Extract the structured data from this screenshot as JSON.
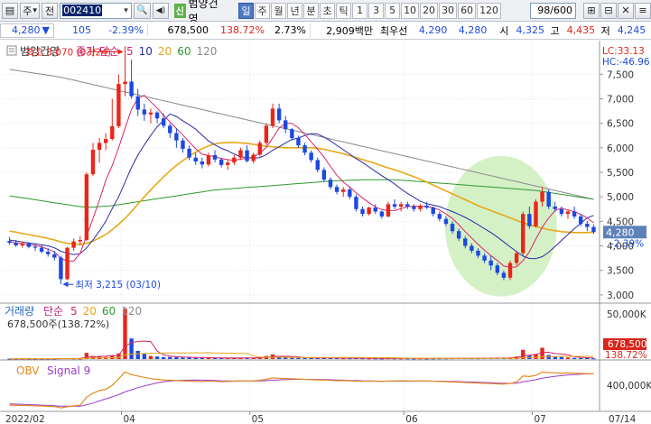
{
  "toolbar": {
    "list_icon": "▤",
    "market": "주",
    "market_arrow": "▾",
    "prev_label": "전",
    "code": "002410",
    "code_arrow": "▾",
    "search_icon": "🔍",
    "sound_icon": "◀)",
    "badge": "신",
    "stock_name": "범양건영",
    "periods": [
      "일",
      "주",
      "월",
      "년",
      "분",
      "초",
      "틱",
      "1",
      "3",
      "5",
      "10",
      "20",
      "30",
      "60",
      "120"
    ],
    "active_period": "일",
    "count": "98/600",
    "right_icons": [
      "⊞",
      "⊟",
      "✕",
      "≡"
    ]
  },
  "quote": {
    "price": "4,280",
    "change_arrow": "▼",
    "change": "105",
    "change_pct": "-2.39%",
    "volume": "678,500",
    "turnover_ratio": "138.72%",
    "ratio2": "2.73%",
    "amount": "2,909백만",
    "best_label": "최우선",
    "ask": "4,290",
    "bid": "4,280",
    "open_label": "시",
    "open": "4,325",
    "high_label": "고",
    "high": "4,435",
    "low_label": "저",
    "low": "4,245"
  },
  "price_panel": {
    "title": "범양건영",
    "legend_label": "종가 단순",
    "ma_periods": [
      "5",
      "10",
      "20",
      "60",
      "120"
    ],
    "lc_label": "LC:33.13",
    "hc_label": "HC:-46.96",
    "y_ticks": [
      "7,500",
      "7,000",
      "6,500",
      "6,000",
      "5,500",
      "5,000",
      "4,500",
      "4,000",
      "3,500",
      "3,000"
    ],
    "current_price": "4,280",
    "current_pct": "-2.39%",
    "high_annotation": "최고 8,070 (03/24)",
    "low_annotation": "최저 3,215 (03/10)"
  },
  "volume_panel": {
    "label": "거래량",
    "legend_label": "단순",
    "ma_periods": [
      "5",
      "20",
      "60",
      "120"
    ],
    "value_label": "678,500주(138.72%)",
    "y_tick": "50,000K",
    "current_value": "678,500",
    "current_pct": "138.72%"
  },
  "obv_panel": {
    "label": "OBV",
    "signal_label": "Signal 9",
    "y_tick": "400,000K"
  },
  "x_axis": {
    "labels": [
      "2022/02",
      "04",
      "05",
      "06",
      "07",
      "07/14"
    ]
  },
  "colors": {
    "up": "#e8261b",
    "down": "#1c48e0",
    "ma5": "#d8246c",
    "ma10": "#2a2aa6",
    "ma20": "#e6a817",
    "ma60": "#2e9a2e",
    "ma120": "#8a8a8a",
    "obv": "#e28a1e",
    "signal": "#9b3ad1",
    "highlight": "#cdeebc",
    "price_box": "#5e82b8",
    "volume_box": "#d8261c"
  },
  "chart_data": {
    "type": "candlestick",
    "price_range": [
      2850,
      8150
    ],
    "candles": [
      [
        4100,
        4180,
        4020,
        4060
      ],
      [
        4060,
        4120,
        3980,
        4010
      ],
      [
        4010,
        4090,
        3960,
        4050
      ],
      [
        4050,
        4070,
        3950,
        3980
      ],
      [
        3980,
        4040,
        3900,
        3960
      ],
      [
        3960,
        4010,
        3850,
        3880
      ],
      [
        3880,
        3950,
        3780,
        3830
      ],
      [
        3830,
        3900,
        3700,
        3760
      ],
      [
        3760,
        3800,
        3215,
        3320
      ],
      [
        3320,
        3980,
        3300,
        3960
      ],
      [
        3960,
        4150,
        3900,
        4090
      ],
      [
        4090,
        4200,
        4010,
        4120
      ],
      [
        4120,
        5500,
        4100,
        5460
      ],
      [
        5460,
        6100,
        5420,
        5960
      ],
      [
        5960,
        6200,
        5700,
        6100
      ],
      [
        6100,
        6300,
        5950,
        6180
      ],
      [
        6180,
        7000,
        6150,
        6440
      ],
      [
        6440,
        7500,
        6400,
        7300
      ],
      [
        7300,
        8070,
        7050,
        7350
      ],
      [
        7350,
        7800,
        7000,
        7050
      ],
      [
        7050,
        7200,
        6650,
        6780
      ],
      [
        6780,
        6900,
        6550,
        6680
      ],
      [
        6680,
        6800,
        6500,
        6720
      ],
      [
        6720,
        6750,
        6500,
        6600
      ],
      [
        6600,
        6700,
        6400,
        6450
      ],
      [
        6450,
        6500,
        6200,
        6300
      ],
      [
        6300,
        6400,
        6000,
        6150
      ],
      [
        6150,
        6200,
        5900,
        5980
      ],
      [
        5980,
        6050,
        5750,
        5800
      ],
      [
        5800,
        5900,
        5650,
        5720
      ],
      [
        5720,
        5800,
        5580,
        5660
      ],
      [
        5660,
        5900,
        5620,
        5850
      ],
      [
        5850,
        5950,
        5700,
        5760
      ],
      [
        5760,
        5800,
        5600,
        5650
      ],
      [
        5650,
        5750,
        5550,
        5700
      ],
      [
        5700,
        5850,
        5650,
        5800
      ],
      [
        5800,
        6000,
        5750,
        5950
      ],
      [
        5950,
        6050,
        5700,
        5730
      ],
      [
        5730,
        5900,
        5680,
        5860
      ],
      [
        5860,
        6150,
        5820,
        6100
      ],
      [
        6100,
        6500,
        6050,
        6450
      ],
      [
        6450,
        6900,
        6400,
        6800
      ],
      [
        6800,
        6900,
        6500,
        6560
      ],
      [
        6560,
        6650,
        6300,
        6380
      ],
      [
        6380,
        6400,
        6150,
        6200
      ],
      [
        6200,
        6250,
        6000,
        6050
      ],
      [
        6050,
        6100,
        5850,
        5900
      ],
      [
        5900,
        5950,
        5700,
        5750
      ],
      [
        5750,
        5800,
        5500,
        5550
      ],
      [
        5550,
        5600,
        5300,
        5350
      ],
      [
        5350,
        5400,
        5150,
        5200
      ],
      [
        5200,
        5250,
        5050,
        5100
      ],
      [
        5100,
        5200,
        5000,
        5150
      ],
      [
        5150,
        5200,
        4950,
        5000
      ],
      [
        5000,
        5050,
        4700,
        4750
      ],
      [
        4750,
        4800,
        4600,
        4650
      ],
      [
        4650,
        4800,
        4620,
        4780
      ],
      [
        4780,
        4850,
        4650,
        4700
      ],
      [
        4700,
        4720,
        4550,
        4600
      ],
      [
        4600,
        4900,
        4580,
        4850
      ],
      [
        4850,
        4950,
        4750,
        4800
      ],
      [
        4800,
        4900,
        4700,
        4850
      ],
      [
        4850,
        4900,
        4750,
        4800
      ],
      [
        4800,
        4850,
        4700,
        4750
      ],
      [
        4750,
        4850,
        4700,
        4820
      ],
      [
        4820,
        4900,
        4750,
        4780
      ],
      [
        4780,
        4800,
        4600,
        4650
      ],
      [
        4650,
        4700,
        4500,
        4550
      ],
      [
        4550,
        4600,
        4400,
        4450
      ],
      [
        4450,
        4500,
        4250,
        4300
      ],
      [
        4300,
        4350,
        4100,
        4150
      ],
      [
        4150,
        4200,
        3950,
        4000
      ],
      [
        4000,
        4050,
        3850,
        3900
      ],
      [
        3900,
        3950,
        3750,
        3800
      ],
      [
        3800,
        3850,
        3650,
        3700
      ],
      [
        3700,
        3800,
        3500,
        3600
      ],
      [
        3600,
        3650,
        3400,
        3450
      ],
      [
        3450,
        3500,
        3300,
        3350
      ],
      [
        3350,
        3700,
        3300,
        3650
      ],
      [
        3650,
        3900,
        3600,
        3850
      ],
      [
        3850,
        4700,
        3800,
        4650
      ],
      [
        4650,
        4800,
        4350,
        4400
      ],
      [
        4400,
        4950,
        4380,
        4900
      ],
      [
        4900,
        5200,
        4800,
        5100
      ],
      [
        5100,
        5150,
        4750,
        4800
      ],
      [
        4800,
        4900,
        4700,
        4750
      ],
      [
        4750,
        4800,
        4600,
        4650
      ],
      [
        4650,
        4750,
        4550,
        4700
      ],
      [
        4700,
        4800,
        4550,
        4600
      ],
      [
        4600,
        4650,
        4400,
        4450
      ],
      [
        4450,
        4500,
        4300,
        4385
      ],
      [
        4385,
        4435,
        4245,
        4280
      ]
    ],
    "ma5": [
      4080,
      4060,
      4040,
      4020,
      4010,
      3980,
      3930,
      3880,
      3740,
      3690,
      3690,
      3850,
      4200,
      4560,
      4930,
      5340,
      5640,
      6000,
      6400,
      6780,
      7010,
      7070,
      6940,
      6810,
      6660,
      6530,
      6390,
      6260,
      6120,
      5980,
      5870,
      5840,
      5820,
      5780,
      5760,
      5740,
      5770,
      5780,
      5820,
      5890,
      6010,
      6200,
      6400,
      6500,
      6500,
      6410,
      6270,
      6120,
      5970,
      5810,
      5620,
      5440,
      5300,
      5200,
      5080,
      4980,
      4880,
      4790,
      4740,
      4720,
      4720,
      4760,
      4800,
      4810,
      4810,
      4800,
      4780,
      4730,
      4650,
      4560,
      4430,
      4290,
      4160,
      4030,
      3910,
      3800,
      3700,
      3590,
      3560,
      3570,
      3700,
      3880,
      4140,
      4380,
      4570,
      4720,
      4770,
      4730,
      4700,
      4640,
      4570,
      4470
    ],
    "ma10": [
      4120,
      4100,
      4080,
      4060,
      4040,
      4020,
      4000,
      3960,
      3890,
      3850,
      3820,
      3840,
      3960,
      4120,
      4300,
      4500,
      4760,
      5000,
      5300,
      5600,
      5850,
      6060,
      6250,
      6430,
      6560,
      6690,
      6640,
      6550,
      6470,
      6380,
      6260,
      6140,
      6060,
      5990,
      5940,
      5870,
      5820,
      5800,
      5790,
      5800,
      5860,
      5950,
      6020,
      6100,
      6170,
      6200,
      6250,
      6290,
      6280,
      6220,
      6140,
      6050,
      5960,
      5870,
      5780,
      5700,
      5610,
      5520,
      5430,
      5350,
      5260,
      5160,
      5070,
      4990,
      4910,
      4860,
      4830,
      4800,
      4750,
      4700,
      4640,
      4580,
      4510,
      4430,
      4350,
      4270,
      4180,
      4080,
      3980,
      3880,
      3790,
      3740,
      3740,
      3780,
      3870,
      3990,
      4110,
      4230,
      4350,
      4460,
      4570,
      4620
    ],
    "ma20": [
      4300,
      4280,
      4250,
      4230,
      4200,
      4180,
      4150,
      4120,
      4080,
      4050,
      4040,
      4030,
      4050,
      4100,
      4160,
      4230,
      4330,
      4440,
      4560,
      4700,
      4850,
      5000,
      5140,
      5280,
      5410,
      5530,
      5640,
      5740,
      5830,
      5910,
      5980,
      6040,
      6080,
      6100,
      6110,
      6110,
      6100,
      6090,
      6070,
      6050,
      6030,
      6020,
      6010,
      6000,
      6000,
      6000,
      6000,
      6000,
      5990,
      5970,
      5940,
      5910,
      5880,
      5840,
      5800,
      5760,
      5720,
      5680,
      5630,
      5590,
      5550,
      5510,
      5460,
      5410,
      5360,
      5300,
      5240,
      5180,
      5120,
      5060,
      5000,
      4940,
      4880,
      4820,
      4770,
      4720,
      4670,
      4620,
      4570,
      4520,
      4470,
      4430,
      4390,
      4360,
      4330,
      4310,
      4290,
      4280,
      4270,
      4270,
      4270,
      4280
    ],
    "ma60": [
      5020,
      5000,
      4980,
      4960,
      4940,
      4920,
      4900,
      4880,
      4860,
      4840,
      4820,
      4800,
      4790,
      4790,
      4800,
      4810,
      4820,
      4840,
      4860,
      4880,
      4900,
      4920,
      4940,
      4960,
      4980,
      5000,
      5020,
      5040,
      5060,
      5080,
      5100,
      5120,
      5140,
      5150,
      5160,
      5170,
      5180,
      5190,
      5200,
      5210,
      5220,
      5230,
      5240,
      5250,
      5260,
      5270,
      5280,
      5290,
      5300,
      5310,
      5320,
      5330,
      5330,
      5340,
      5340,
      5350,
      5350,
      5350,
      5350,
      5350,
      5350,
      5340,
      5330,
      5320,
      5310,
      5300,
      5290,
      5280,
      5270,
      5260,
      5250,
      5240,
      5230,
      5220,
      5210,
      5200,
      5190,
      5180,
      5170,
      5160,
      5150,
      5140,
      5130,
      5110,
      5090,
      5070,
      5050,
      5030,
      5010,
      4990,
      4970,
      4950
    ],
    "ma120": [
      7600,
      7580,
      7560,
      7540,
      7520,
      7500,
      7480,
      7460,
      7440,
      7410,
      7380,
      7350,
      7320,
      7290,
      7260,
      7230,
      7200,
      7170,
      7140,
      7110,
      7080,
      7050,
      7020,
      6990,
      6960,
      6930,
      6900,
      6870,
      6840,
      6810,
      6780,
      6750,
      6720,
      6690,
      6660,
      6630,
      6600,
      6570,
      6540,
      6510,
      6480,
      6450,
      6420,
      6390,
      6360,
      6330,
      6300,
      6270,
      6240,
      6210,
      6180,
      6150,
      6120,
      6090,
      6060,
      6030,
      6000,
      5970,
      5940,
      5910,
      5880,
      5850,
      5820,
      5790,
      5760,
      5730,
      5700,
      5670,
      5640,
      5610,
      5580,
      5550,
      5520,
      5490,
      5460,
      5430,
      5400,
      5370,
      5340,
      5310,
      5280,
      5250,
      5220,
      5190,
      5160,
      5130,
      5100,
      5070,
      5040,
      5010,
      4980,
      4950
    ],
    "volume_k": [
      300,
      250,
      280,
      220,
      200,
      260,
      240,
      230,
      900,
      800,
      600,
      500,
      6000,
      3000,
      2500,
      2000,
      3500,
      5500,
      49000,
      20000,
      8000,
      5000,
      3000,
      2500,
      2000,
      2000,
      1800,
      1500,
      1500,
      1200,
      1200,
      1300,
      1100,
      1000,
      1000,
      1100,
      1200,
      1100,
      1000,
      2000,
      3000,
      4500,
      2500,
      1500,
      1200,
      1100,
      1000,
      1100,
      1200,
      1100,
      1000,
      900,
      800,
      800,
      900,
      800,
      700,
      700,
      600,
      800,
      700,
      600,
      600,
      500,
      600,
      500,
      600,
      700,
      700,
      800,
      900,
      900,
      800,
      800,
      900,
      1000,
      1200,
      1000,
      1500,
      2500,
      9000,
      4000,
      5000,
      11000,
      4000,
      2500,
      2000,
      1500,
      1200,
      1000,
      900,
      678.5
    ],
    "obv_k": [
      80,
      78,
      79,
      77,
      75,
      74,
      72,
      70,
      60,
      68,
      75,
      80,
      140,
      170,
      190,
      200,
      230,
      280,
      330,
      310,
      300,
      290,
      280,
      275,
      270,
      268,
      266,
      264,
      262,
      260,
      258,
      262,
      260,
      258,
      259,
      261,
      263,
      262,
      263,
      268,
      275,
      285,
      283,
      281,
      279,
      277,
      275,
      273,
      271,
      269,
      267,
      265,
      266,
      264,
      262,
      260,
      262,
      261,
      259,
      262,
      263,
      264,
      263,
      262,
      263,
      262,
      261,
      259,
      257,
      255,
      253,
      251,
      249,
      247,
      245,
      243,
      241,
      239,
      245,
      255,
      300,
      296,
      305,
      330,
      326,
      324,
      322,
      323,
      321,
      319,
      318,
      317
    ],
    "signal_k": [
      90,
      88,
      86,
      84,
      82,
      80,
      78,
      76,
      73,
      72,
      72,
      73,
      82,
      96,
      112,
      128,
      143,
      160,
      180,
      196,
      212,
      225,
      237,
      248,
      256,
      262,
      266,
      268,
      269,
      270,
      269,
      268,
      266,
      264,
      263,
      262,
      262,
      262,
      262,
      263,
      265,
      268,
      271,
      273,
      274,
      275,
      275,
      275,
      274,
      273,
      272,
      270,
      269,
      267,
      266,
      264,
      263,
      262,
      261,
      261,
      261,
      261,
      261,
      261,
      262,
      262,
      261,
      261,
      260,
      259,
      258,
      256,
      255,
      253,
      251,
      249,
      247,
      245,
      245,
      246,
      256,
      264,
      272,
      283,
      291,
      298,
      303,
      308,
      311,
      314,
      316,
      317
    ]
  }
}
